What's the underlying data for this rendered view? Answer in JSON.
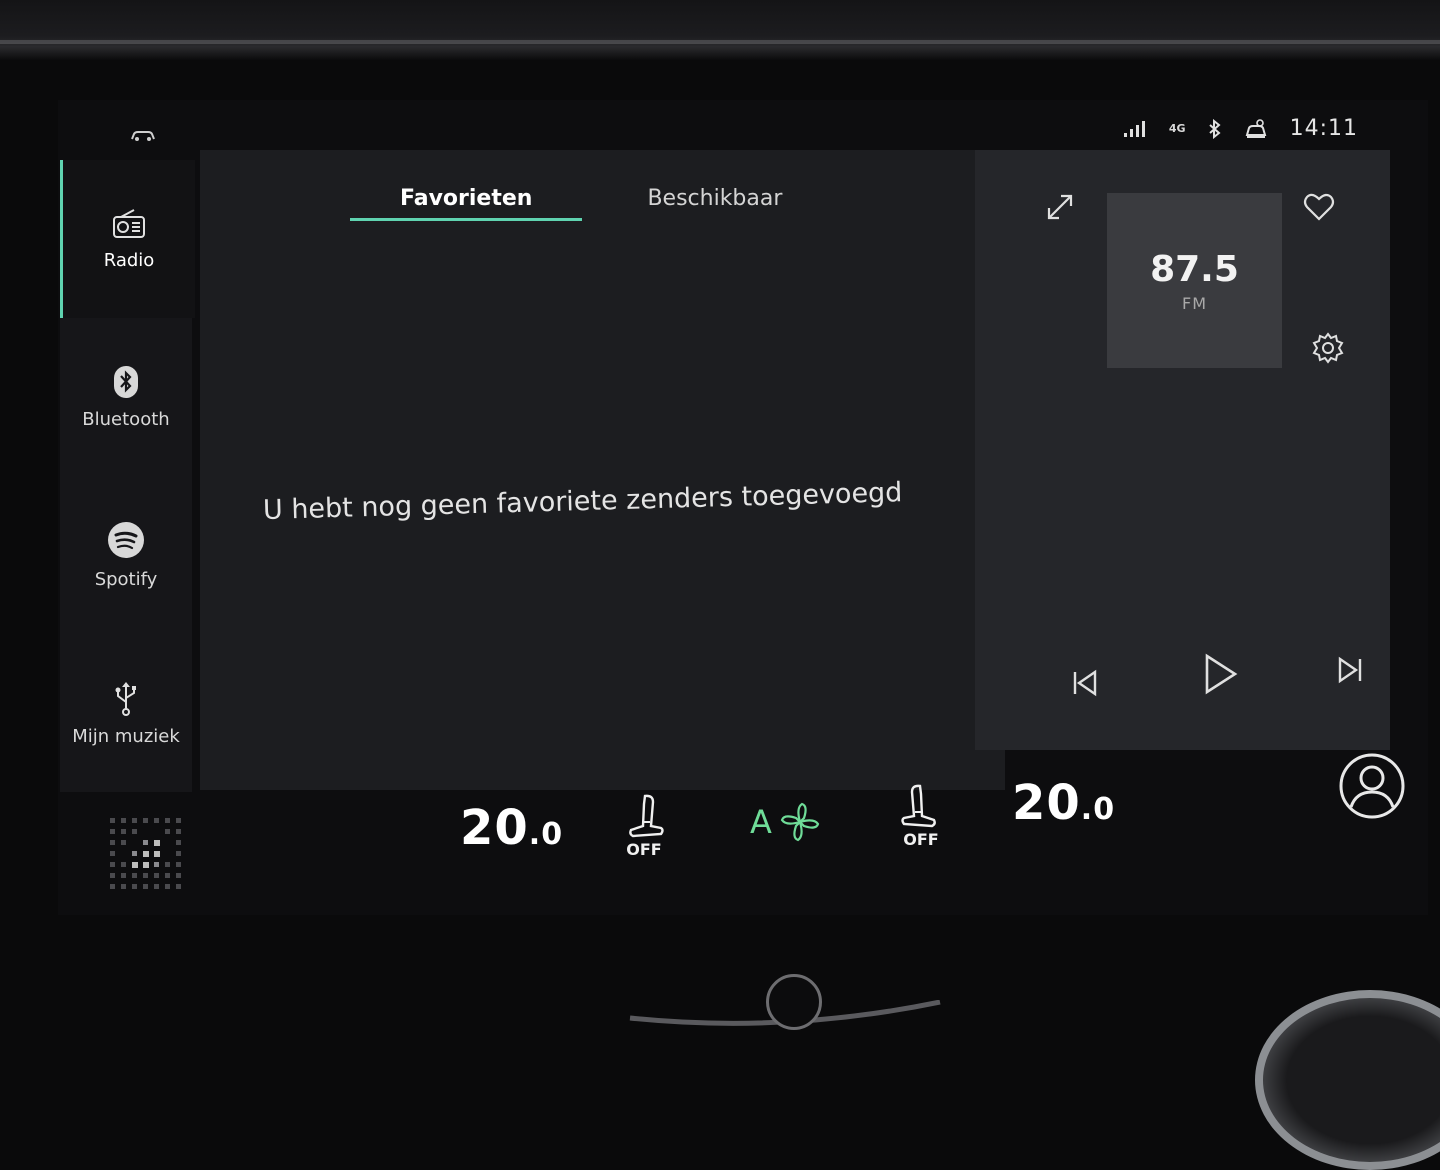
{
  "status_bar": {
    "network": "4G",
    "time": "14:11",
    "icons": [
      "car-icon",
      "signal-icon",
      "bluetooth-icon",
      "vehicle-status-icon"
    ]
  },
  "sidebar": {
    "items": [
      {
        "label": "Radio",
        "icon": "radio-icon",
        "active": true
      },
      {
        "label": "Bluetooth",
        "icon": "bluetooth-icon",
        "active": false
      },
      {
        "label": "Spotify",
        "icon": "spotify-icon",
        "active": false
      },
      {
        "label": "Mijn muziek",
        "icon": "usb-icon",
        "active": false
      }
    ]
  },
  "tabs": [
    {
      "label": "Favorieten",
      "active": true
    },
    {
      "label": "Beschikbaar",
      "active": false
    }
  ],
  "empty_message": "U hebt nog geen favoriete zenders toegevoegd",
  "player": {
    "frequency": "87.5",
    "band": "FM",
    "controls": [
      "previous-icon",
      "play-icon",
      "next-icon"
    ]
  },
  "climate": {
    "left_temp": "20",
    "left_temp_decimal": ".0",
    "left_seat_label": "OFF",
    "fan_mode": "A",
    "right_seat_label": "OFF",
    "right_temp": "20",
    "right_temp_decimal": ".0"
  },
  "colors": {
    "accent": "#5fd3b0",
    "fan_green": "#6fdc98",
    "panel": "#1c1d20",
    "player_panel": "#25262a"
  }
}
